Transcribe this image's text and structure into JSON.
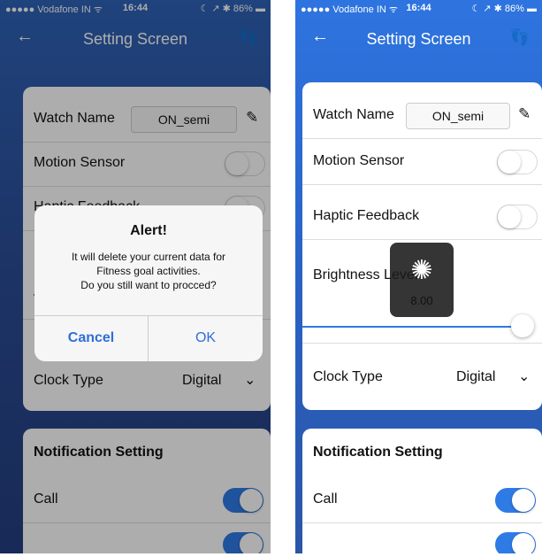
{
  "status_bar": {
    "carrier": "●●●●● Vodafone IN ᯤ",
    "time": "16:44",
    "right": "☾ ↗ ✱ 86% ▬"
  },
  "nav": {
    "back_icon": "back-arrow-icon",
    "title": "Setting Screen",
    "right_icon": "footprints-icon"
  },
  "settings": {
    "watch_name_label": "Watch Name",
    "watch_name_value": "ON_semi",
    "edit_icon": "edit-icon",
    "motion_sensor_label": "Motion Sensor",
    "motion_sensor_on": false,
    "haptic_feedback_label": "Haptic Feedback",
    "haptic_feedback_on": false,
    "brightness_label": "Brightness Level",
    "brightness_value": "8.00",
    "brightness_fraction": 1.0,
    "clock_type_label": "Clock Type",
    "clock_type_value": "Digital"
  },
  "notifications": {
    "section_title": "Notification Setting",
    "call_label": "Call",
    "call_on": true
  },
  "alert": {
    "title": "Alert!",
    "message_line1": "It will delete your current data for",
    "message_line2": "Fitness goal activities.",
    "message_line3": "Do you still want to procced?",
    "cancel_label": "Cancel",
    "ok_label": "OK"
  },
  "colors": {
    "accent": "#2f7be6",
    "header_left": "#2f63b8",
    "header_right": "#2e74e0"
  }
}
